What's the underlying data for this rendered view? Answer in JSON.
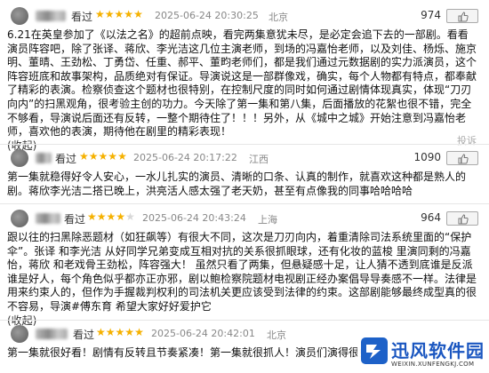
{
  "reviews": [
    {
      "verb": "看过",
      "rating": 5,
      "date": "2025-06-24 20:30:25",
      "location": "北京",
      "votes": "974",
      "vote_action": "有用",
      "text": "6.21在英皇参加了《以法之名》的超前点映，看完两集意犹未尽，是必定会追下去的一部剧。看看演员阵容吧，除了张译、蒋欣、李光洁这几位主演老师，到场的冯嘉怡老师，以及刘佳、杨烁、施京明、董晴、王劲松、丁勇岱、任重、郝平、董畇老师们，都是我们通过元数据剧的实力派演员，这个阵容班底和故事架构，品质绝对有保证。导演说这是一部群像戏，确实，每个人物都有特点，都奉献了精彩的表演。检察侦查这个题材也很特别，在控制尺度的同时如何通过剧情体现真实，体现“刀刃向内”的扫黑观角，很考验主创的功力。今天除了第一集和第八集，后面播放的花絮也很不错，完全不够看，导演说后面还有反转，一整个期待住了！！！另外，从《城中之城》开始注意到冯嘉怡老师，喜欢他的表演，期待他在剧里的精彩表现！",
      "collapse": "(收起)",
      "report": "投诉"
    },
    {
      "verb": "看过",
      "rating": 5,
      "date": "2025-06-24 20:17:22",
      "location": "江西",
      "votes": "1090",
      "vote_action": "有用",
      "text": "第一集就稳得好令人安心，一水儿扎实的演员、清晰的口条、认真的制作，就喜欢这种都是熟人的剧。蒋欣李光洁二搭已晚上，洪亮活人感太强了老天奶，甚至有点像我的同事哈哈哈哈"
    },
    {
      "verb": "看过",
      "rating": 4,
      "date": "2025-06-24 20:43:24",
      "location": "上海",
      "votes": "964",
      "vote_action": "有用",
      "text": "跟以往的扫黑除恶题材（如狂飙等）有很大不同，这次是刀刃向内，着重清除司法系统里面的“保护伞”。张译 和李光洁 从好同学兄弟变成互相对抗的关系很抓眼球，还有化妆的蓝梭 里演同剩的冯嘉怡，蒋欣 和老戏骨王劲松，阵容强大！ 虽然只看了两集，但悬疑感十足，让人猜不透到底谁是反派谁是好人，每个角色似乎都亦正亦邪，剧以鲍检察院题材电视剧正经办案倡导导奏感不一样。法律是用来约束人的，但作为手握裁判权利的司法机关更应该受到法律的约束。这部剧能够最终成型真的很不容易，导演#傅东育 希望大家好好爱护它",
      "collapse": "(收起)"
    },
    {
      "verb": "看过",
      "rating": 5,
      "date": "2025-06-24 20:42:01",
      "location": "北京",
      "text": "第一集就很好看！剧情有反转且节奏紧凑！第一集就很抓人！演员们演得很好！"
    }
  ],
  "watermark": {
    "name": "迅风软件园",
    "url": "WEIXIN.XUNFENGKJ.COM"
  },
  "colors": {
    "star": "#f5b100",
    "star_off": "#d8d8d8",
    "meta": "#888888",
    "brand": "#1a56c0"
  }
}
